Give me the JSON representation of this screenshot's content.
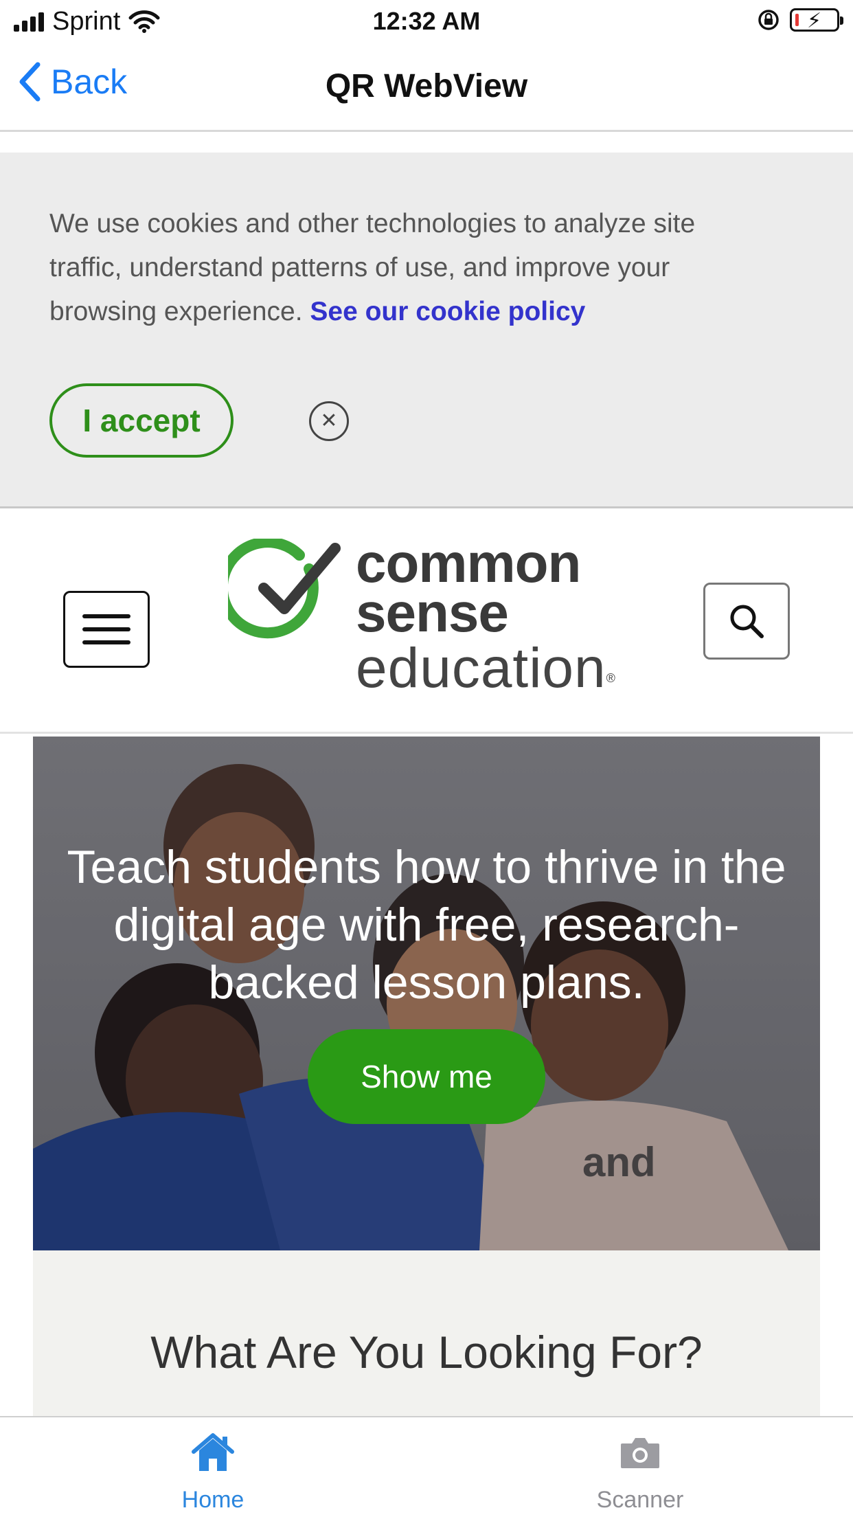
{
  "status_bar": {
    "carrier": "Sprint",
    "time": "12:32 AM"
  },
  "nav": {
    "back_label": "Back",
    "title": "QR WebView"
  },
  "cookie_banner": {
    "text": "We use cookies and other technologies to analyze site traffic, understand patterns of use, and improve your browsing experience. ",
    "link_label": "See our cookie policy",
    "accept_label": "I accept",
    "dismiss_symbol": "✕"
  },
  "site_header": {
    "logo_line1": "common",
    "logo_line2": "sense",
    "logo_line3": "education",
    "logo_registered": "®"
  },
  "hero": {
    "headline": "Teach students how to thrive in the digital age with free, research-backed lesson plans.",
    "cta_label": "Show me"
  },
  "section": {
    "title": "What Are You Looking For?"
  },
  "tab_bar": {
    "tabs": [
      {
        "label": "Home",
        "icon": "home-icon",
        "active": true
      },
      {
        "label": "Scanner",
        "icon": "camera-icon",
        "active": false
      }
    ]
  },
  "colors": {
    "ios_blue": "#1a7cf5",
    "brand_green": "#2a9a15",
    "link_blue": "#3333cc",
    "tab_active": "#2b86de",
    "tab_inactive": "#8e8e93"
  }
}
